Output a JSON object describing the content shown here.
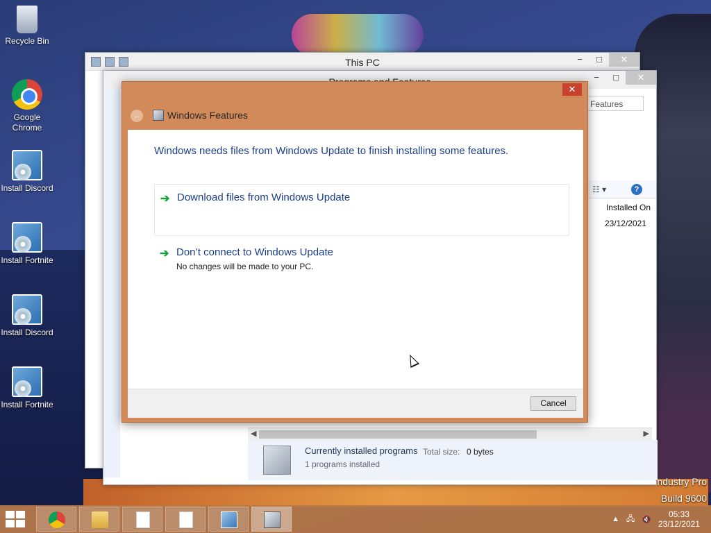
{
  "desktop": {
    "icons": [
      {
        "label": "Recycle Bin"
      },
      {
        "label": "Google Chrome"
      },
      {
        "label": "Install Discord"
      },
      {
        "label": "Install Fortnite"
      },
      {
        "label": "Install Discord"
      },
      {
        "label": "Install Fortnite"
      }
    ],
    "watermark": {
      "line1": "ndustry Pro",
      "line2": "Build 9600"
    }
  },
  "this_pc_window": {
    "title": "This PC"
  },
  "programs_window": {
    "title": "Programs and Features",
    "search_placeholder": "Features",
    "column_installed_on": "Installed On",
    "row_date": "23/12/2021",
    "status": {
      "heading": "Currently installed programs",
      "total_size_label": "Total size:",
      "total_size_value": "0 bytes",
      "count": "1 programs installed"
    }
  },
  "dialog": {
    "title": "Windows Features",
    "message": "Windows needs files from Windows Update to finish installing some features.",
    "options": [
      {
        "label": "Download files from Windows Update",
        "sub": ""
      },
      {
        "label": "Don’t connect to Windows Update",
        "sub": "No changes will be made to your PC."
      }
    ],
    "cancel_label": "Cancel",
    "close_glyph": "✕",
    "back_glyph": "←",
    "option_arrow": "➔"
  },
  "caption": {
    "minimize": "−",
    "maximize": "□",
    "close": "✕"
  },
  "taskbar": {
    "clock_time": "05:33",
    "clock_date": "23/12/2021",
    "tray_up": "▲",
    "icons": [
      "windows-start-icon",
      "chrome-icon",
      "file-explorer-icon",
      "document-icon",
      "document-icon",
      "network-icon",
      "package-icon"
    ]
  }
}
